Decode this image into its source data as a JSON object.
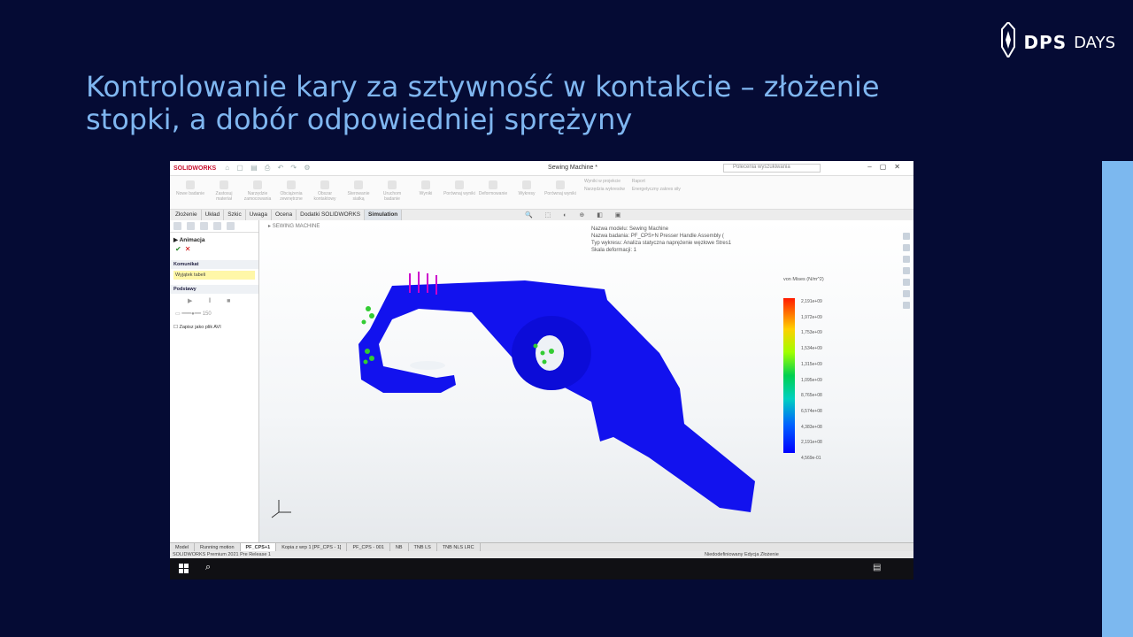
{
  "slide": {
    "title": "Kontrolowanie kary za sztywność w kontakcie – złożenie stopki, a dobór odpowiedniej sprężyny",
    "logo_dps": "DPS",
    "logo_days": "DAYS"
  },
  "app": {
    "brand": "SOLIDWORKS",
    "document_title": "Sewing Machine *",
    "search_placeholder": "Polecenia wyszukiwania",
    "ribbon": [
      "Nowe badanie",
      "Zastosuj materiał",
      "Narzędzie zamocowania",
      "Obciążenia zewnętrzne",
      "Obszar kontaktowy",
      "Sterowanie siatką",
      "Uruchom badanie",
      "Wyniki",
      "Porównaj wyniki",
      "Deformowanie",
      "Wykresy",
      "Porównaj wyniki"
    ],
    "ribbon_side": [
      "Wyniki w projekcie",
      "Narzędzia wykresów",
      "Raport",
      "Energetyczny zakres siły"
    ],
    "tabs": [
      "Złożenie",
      "Układ",
      "Szkic",
      "Uwaga",
      "Ocena",
      "Dodatki SOLIDWORKS",
      "Simulation"
    ],
    "active_tab": "Simulation"
  },
  "property_manager": {
    "header": "Animacja",
    "message_section": "Komunikat",
    "message_text": "Wyjątek tabeli",
    "basic_section": "Podstawy",
    "frames_label": "150",
    "save_avi_label": "Zapisz jako plik AVI"
  },
  "viewport": {
    "tree_root": "SEWING MACHINE",
    "info_lines": [
      "Nazwa modelu: Sewing Machine",
      "Nazwa badania: PF_CPS+N Presser Handle Assembly (",
      "Typ wykresu: Analiza statyczna naprężenie węzłowe Stres1",
      "Skala deformacji: 1"
    ],
    "legend_title": "von Mises (N/m^2)",
    "legend_values": [
      "2,191e+09",
      "1,972e+09",
      "1,753e+09",
      "1,534e+09",
      "1,315e+09",
      "1,095e+09",
      "8,765e+08",
      "6,574e+08",
      "4,383e+08",
      "2,191e+08",
      "4,569e-01"
    ],
    "colors": {
      "part": "#1010ee",
      "part_dark": "#0808c0",
      "constraint": "#33cc33",
      "load": "#cc00cc"
    }
  },
  "bottom_tabs": [
    "Model",
    "Running motion",
    "PF_CPS+1",
    "Kopia z wrp 1 [PF_CPS - 1]",
    "PF_CPS - 001",
    "NB",
    "TNB LS",
    "TNB NLS LRC"
  ],
  "active_bottom_tab": "PF_CPS+1",
  "status": {
    "left": "SOLIDWORKS Premium 2021 Pre Release 1",
    "right": "Niedodefiniowany    Edycja Złożenie"
  }
}
